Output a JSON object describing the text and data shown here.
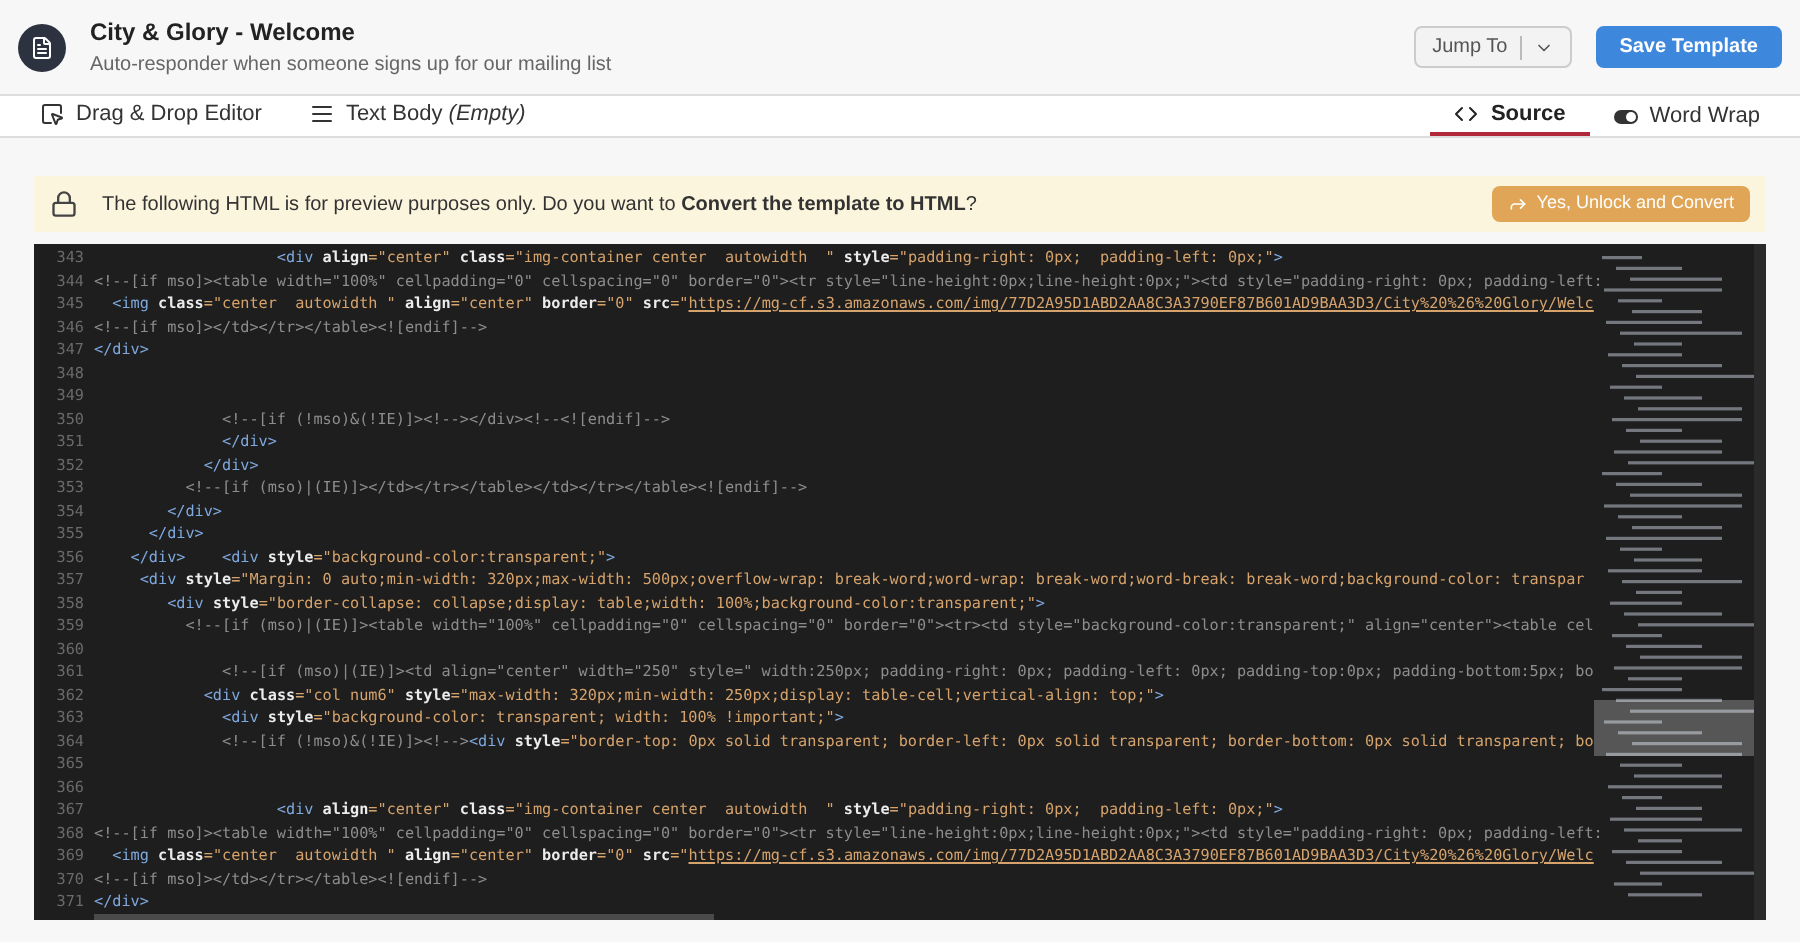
{
  "header": {
    "title": "City & Glory - Welcome",
    "subtitle": "Auto-responder when someone signs up for our mailing list",
    "jump_button": "Jump To",
    "save_button": "Save Template"
  },
  "tabs": [
    {
      "label": "Drag & Drop Editor",
      "selected": false,
      "kind": "editor"
    },
    {
      "label": "Text Body *(Empty)*",
      "selected": false,
      "kind": "text"
    },
    {
      "label": "Source",
      "selected": true,
      "kind": "source"
    }
  ],
  "word_wrap": {
    "label": "Word Wrap",
    "on": true
  },
  "banner": {
    "message": "The following HTML is for preview purposes only. Do you want to **Convert the template to HTML**?",
    "button": "Yes, Unlock and Convert"
  },
  "editor": {
    "lines": [
      {
        "number": "343",
        "tokens": [
          {
            "kind": "tag",
            "text": "                    <div"
          },
          {
            "kind": "attr",
            "text": " align"
          },
          {
            "kind": "str",
            "text": "=\"center\""
          },
          {
            "kind": "attr",
            "text": " class"
          },
          {
            "kind": "str",
            "text": "=\"img-container center  autowidth  \""
          },
          {
            "kind": "attr",
            "text": " style"
          },
          {
            "kind": "str",
            "text": "=\"padding-right: 0px;  padding-left: 0px;\""
          },
          {
            "kind": "tag",
            "text": ">"
          }
        ]
      },
      {
        "number": "344",
        "tokens": [
          {
            "kind": "comment",
            "text": "<!--[if mso]><table width=\"100%\" cellpadding=\"0\" cellspacing=\"0\" border=\"0\"><tr style=\"line-height:0px;line-height:0px;\"><td style=\"padding-right: 0px; padding-left:"
          }
        ]
      },
      {
        "number": "345",
        "tokens": [
          {
            "kind": "tag",
            "text": "  <img"
          },
          {
            "kind": "attr",
            "text": " class"
          },
          {
            "kind": "str",
            "text": "=\"center  autowidth \""
          },
          {
            "kind": "attr",
            "text": " align"
          },
          {
            "kind": "str",
            "text": "=\"center\""
          },
          {
            "kind": "attr",
            "text": " border"
          },
          {
            "kind": "str",
            "text": "=\"0\""
          },
          {
            "kind": "attr",
            "text": " src"
          },
          {
            "kind": "str",
            "text": "=\""
          },
          {
            "kind": "link",
            "text": "https://mg-cf.s3.amazonaws.com/img/77D2A95D1ABD2AA8C3A3790EF87B601AD9BAA3D3/City%20%26%20Glory/Welc"
          }
        ]
      },
      {
        "number": "346",
        "tokens": [
          {
            "kind": "comment",
            "text": "<!--[if mso]></td></tr></table><![endif]-->"
          }
        ]
      },
      {
        "number": "347",
        "tokens": [
          {
            "kind": "tag",
            "text": "</div>"
          }
        ]
      },
      {
        "number": "348"
      },
      {
        "number": "349"
      },
      {
        "number": "350",
        "tokens": [
          {
            "kind": "comment",
            "text": "              <!--[if (!mso)&(!IE)]><!--></div><!--<![endif]-->"
          }
        ]
      },
      {
        "number": "351",
        "tokens": [
          {
            "kind": "tag",
            "text": "              </div>"
          }
        ]
      },
      {
        "number": "352",
        "tokens": [
          {
            "kind": "tag",
            "text": "            </div>"
          }
        ]
      },
      {
        "number": "353",
        "tokens": [
          {
            "kind": "comment",
            "text": "          <!--[if (mso)|(IE)]></td></tr></table></td></tr></table><![endif]-->"
          }
        ]
      },
      {
        "number": "354",
        "tokens": [
          {
            "kind": "tag",
            "text": "        </div>"
          }
        ]
      },
      {
        "number": "355",
        "tokens": [
          {
            "kind": "tag",
            "text": "      </div>"
          }
        ]
      },
      {
        "number": "356",
        "tokens": [
          {
            "kind": "tag",
            "text": "    </div>    <div"
          },
          {
            "kind": "attr",
            "text": " style"
          },
          {
            "kind": "str",
            "text": "=\"background-color:transparent;\""
          },
          {
            "kind": "tag",
            "text": ">"
          }
        ]
      },
      {
        "number": "357",
        "tokens": [
          {
            "kind": "tag",
            "text": "     <div"
          },
          {
            "kind": "attr",
            "text": " style"
          },
          {
            "kind": "str",
            "text": "=\"Margin: 0 auto;min-width: 320px;max-width: 500px;overflow-wrap: break-word;word-wrap: break-word;word-break: break-word;background-color: transpar"
          }
        ]
      },
      {
        "number": "358",
        "tokens": [
          {
            "kind": "tag",
            "text": "        <div"
          },
          {
            "kind": "attr",
            "text": " style"
          },
          {
            "kind": "str",
            "text": "=\"border-collapse: collapse;display: table;width: 100%;background-color:transparent;\""
          },
          {
            "kind": "tag",
            "text": ">"
          }
        ]
      },
      {
        "number": "359",
        "tokens": [
          {
            "kind": "comment",
            "text": "          <!--[if (mso)|(IE)]><table width=\"100%\" cellpadding=\"0\" cellspacing=\"0\" border=\"0\"><tr><td style=\"background-color:transparent;\" align=\"center\"><table cel"
          }
        ]
      },
      {
        "number": "360"
      },
      {
        "number": "361",
        "tokens": [
          {
            "kind": "comment",
            "text": "              <!--[if (mso)|(IE)]><td align=\"center\" width=\"250\" style=\" width:250px; padding-right: 0px; padding-left: 0px; padding-top:0px; padding-bottom:5px; bo"
          }
        ]
      },
      {
        "number": "362",
        "tokens": [
          {
            "kind": "tag",
            "text": "            <div"
          },
          {
            "kind": "attr",
            "text": " class"
          },
          {
            "kind": "str",
            "text": "=\"col num6\""
          },
          {
            "kind": "attr",
            "text": " style"
          },
          {
            "kind": "str",
            "text": "=\"max-width: 320px;min-width: 250px;display: table-cell;vertical-align: top;\""
          },
          {
            "kind": "tag",
            "text": ">"
          }
        ]
      },
      {
        "number": "363",
        "tokens": [
          {
            "kind": "tag",
            "text": "              <div"
          },
          {
            "kind": "attr",
            "text": " style"
          },
          {
            "kind": "str",
            "text": "=\"background-color: transparent; width: 100% !important;\""
          },
          {
            "kind": "tag",
            "text": ">"
          }
        ]
      },
      {
        "number": "364",
        "tokens": [
          {
            "kind": "comment",
            "text": "              <!--[if (!mso)&(!IE)]><!-->"
          },
          {
            "kind": "tag",
            "text": "<div"
          },
          {
            "kind": "attr",
            "text": " style"
          },
          {
            "kind": "str",
            "text": "=\"border-top: 0px solid transparent; border-left: 0px solid transparent; border-bottom: 0px solid transparent; bo"
          }
        ]
      },
      {
        "number": "365"
      },
      {
        "number": "366"
      },
      {
        "number": "367",
        "tokens": [
          {
            "kind": "tag",
            "text": "                    <div"
          },
          {
            "kind": "attr",
            "text": " align"
          },
          {
            "kind": "str",
            "text": "=\"center\""
          },
          {
            "kind": "attr",
            "text": " class"
          },
          {
            "kind": "str",
            "text": "=\"img-container center  autowidth  \""
          },
          {
            "kind": "attr",
            "text": " style"
          },
          {
            "kind": "str",
            "text": "=\"padding-right: 0px;  padding-left: 0px;\""
          },
          {
            "kind": "tag",
            "text": ">"
          }
        ]
      },
      {
        "number": "368",
        "tokens": [
          {
            "kind": "comment",
            "text": "<!--[if mso]><table width=\"100%\" cellpadding=\"0\" cellspacing=\"0\" border=\"0\"><tr style=\"line-height:0px;line-height:0px;\"><td style=\"padding-right: 0px; padding-left:"
          }
        ]
      },
      {
        "number": "369",
        "tokens": [
          {
            "kind": "tag",
            "text": "  <img"
          },
          {
            "kind": "attr",
            "text": " class"
          },
          {
            "kind": "str",
            "text": "=\"center  autowidth \""
          },
          {
            "kind": "attr",
            "text": " align"
          },
          {
            "kind": "str",
            "text": "=\"center\""
          },
          {
            "kind": "attr",
            "text": " border"
          },
          {
            "kind": "str",
            "text": "=\"0\""
          },
          {
            "kind": "attr",
            "text": " src"
          },
          {
            "kind": "str",
            "text": "=\""
          },
          {
            "kind": "link",
            "text": "https://mg-cf.s3.amazonaws.com/img/77D2A95D1ABD2AA8C3A3790EF87B601AD9BAA3D3/City%20%26%20Glory/Welc"
          }
        ]
      },
      {
        "number": "370",
        "tokens": [
          {
            "kind": "comment",
            "text": "<!--[if mso]></td></tr></table><![endif]-->"
          }
        ]
      },
      {
        "number": "371",
        "tokens": [
          {
            "kind": "tag",
            "text": "</div>"
          }
        ]
      }
    ]
  }
}
